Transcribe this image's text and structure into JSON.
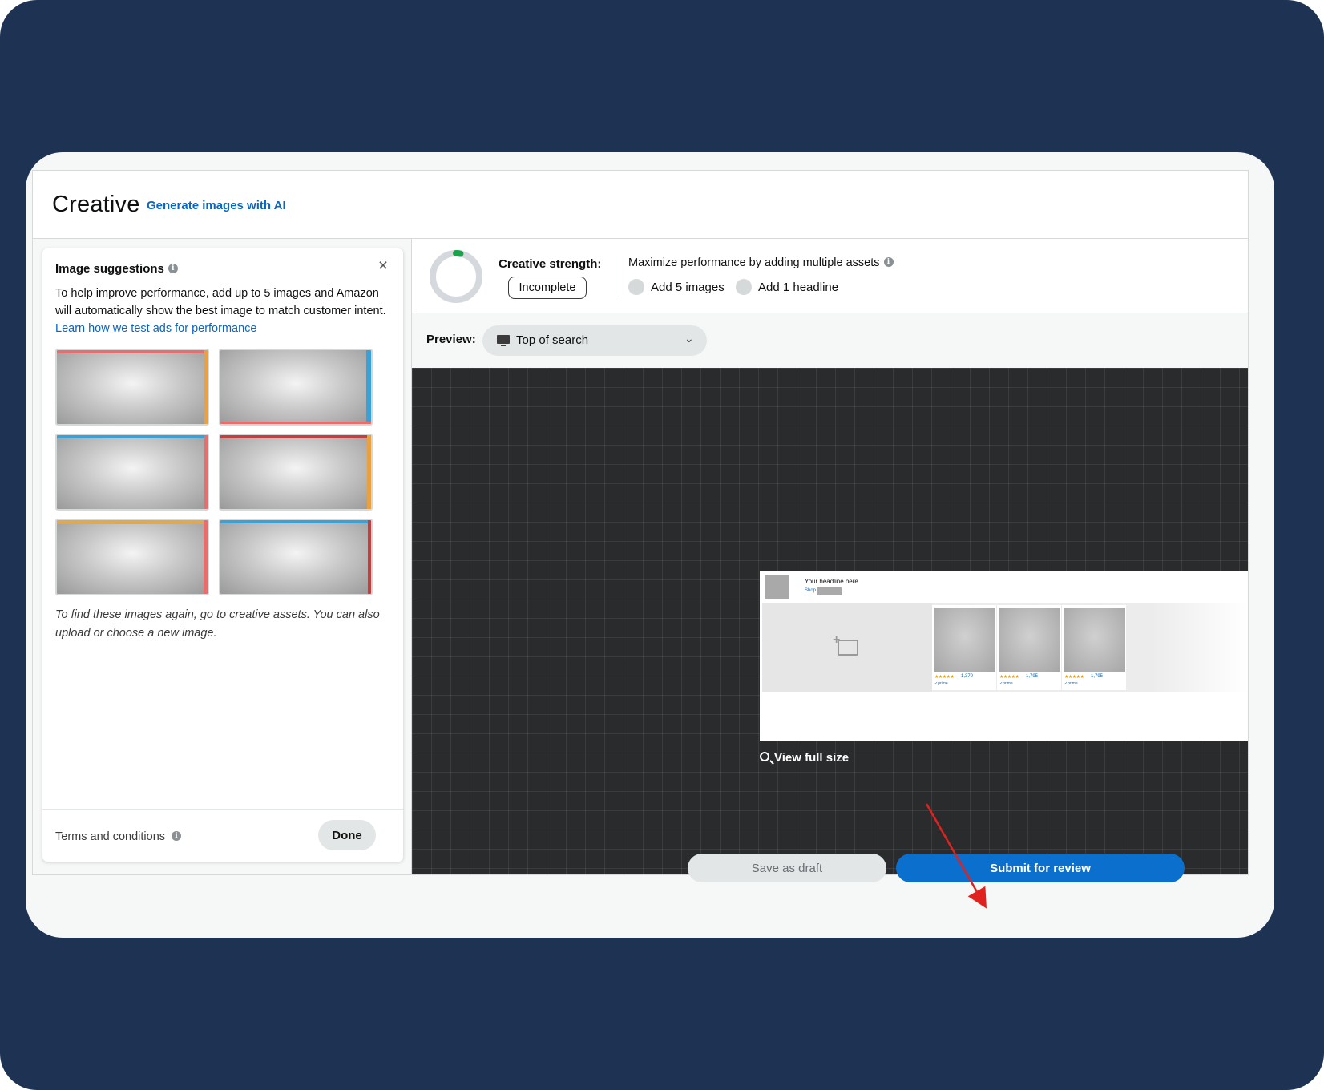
{
  "header": {
    "title": "Creative",
    "generate_link": "Generate images with AI"
  },
  "suggestions": {
    "title": "Image suggestions",
    "close": "×",
    "desc": "To help improve performance, add up to 5 images and Amazon will automatically show the best image to match customer intent.",
    "learn_link": "Learn how we test ads for performance",
    "note": "To find these images again, go to creative assets. You can also upload or choose a new image.",
    "terms": "Terms and conditions",
    "done": "Done"
  },
  "strength": {
    "label": "Creative strength:",
    "status": "Incomplete",
    "maximize": "Maximize performance by adding multiple assets",
    "task1": "Add 5 images",
    "task2": "Add 1 headline",
    "ring_fraction": 0.03
  },
  "preview": {
    "label": "Preview:",
    "selected": "Top of search",
    "chevron": "⌄"
  },
  "ad": {
    "headline": "Your headline here",
    "shop": "Shop",
    "stars": "★★★★★",
    "counts": [
      "1,370",
      "1,795",
      "1,795"
    ]
  },
  "view_full": "View full size",
  "buttons": {
    "save_draft": "Save as draft",
    "submit": "Submit for review"
  },
  "colors": {
    "frame": "#1e3353",
    "accent_blue": "#0b6fce",
    "link_blue": "#0b66c2",
    "ring_green": "#1aa34a",
    "annotation_red": "#e0221f"
  }
}
